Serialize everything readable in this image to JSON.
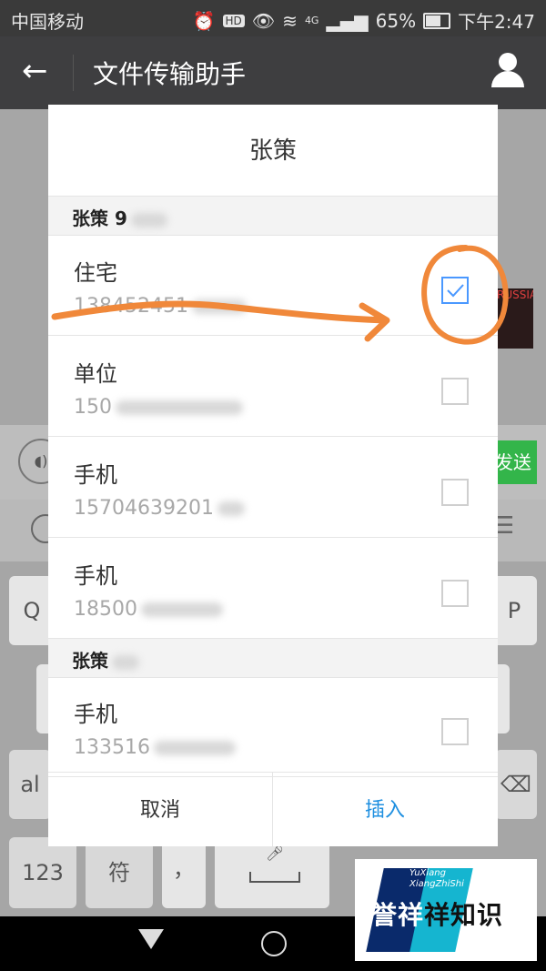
{
  "status_bar": {
    "carrier": "中国移动",
    "hd_badge": "HD",
    "network_badge": "4G",
    "battery": "65%",
    "battery_level": 0.65,
    "time": "下午2:47"
  },
  "header": {
    "back_icon": "←",
    "title": "文件传输助手"
  },
  "background": {
    "send_label": "发送",
    "keys": [
      {
        "label": "Q"
      },
      {
        "label": "P"
      },
      {
        "label": "al"
      },
      {
        "label": "123"
      },
      {
        "label": "符"
      },
      {
        "label": "，"
      }
    ]
  },
  "dialog": {
    "title": "张策",
    "groups": [
      {
        "name": "张策 9",
        "entries": [
          {
            "label": "住宅",
            "number": "138452451",
            "checked": true
          },
          {
            "label": "单位",
            "number": "150",
            "checked": false
          },
          {
            "label": "手机",
            "number": "15704639201",
            "checked": false
          },
          {
            "label": "手机",
            "number": "18500",
            "checked": false
          }
        ]
      },
      {
        "name": "张策",
        "entries": [
          {
            "label": "手机",
            "number": "133516",
            "checked": false
          }
        ]
      }
    ],
    "cancel_label": "取消",
    "insert_label": "插入"
  },
  "watermark": {
    "line1": "YuXiang",
    "line2": "XiangZhiShi",
    "text_a": "誉祥",
    "text_b": "祥知识"
  },
  "annotation_color": "#f0883a",
  "accent_color": "#1e8fe0",
  "check_color": "#4a98ff",
  "send_color": "#33b54a"
}
